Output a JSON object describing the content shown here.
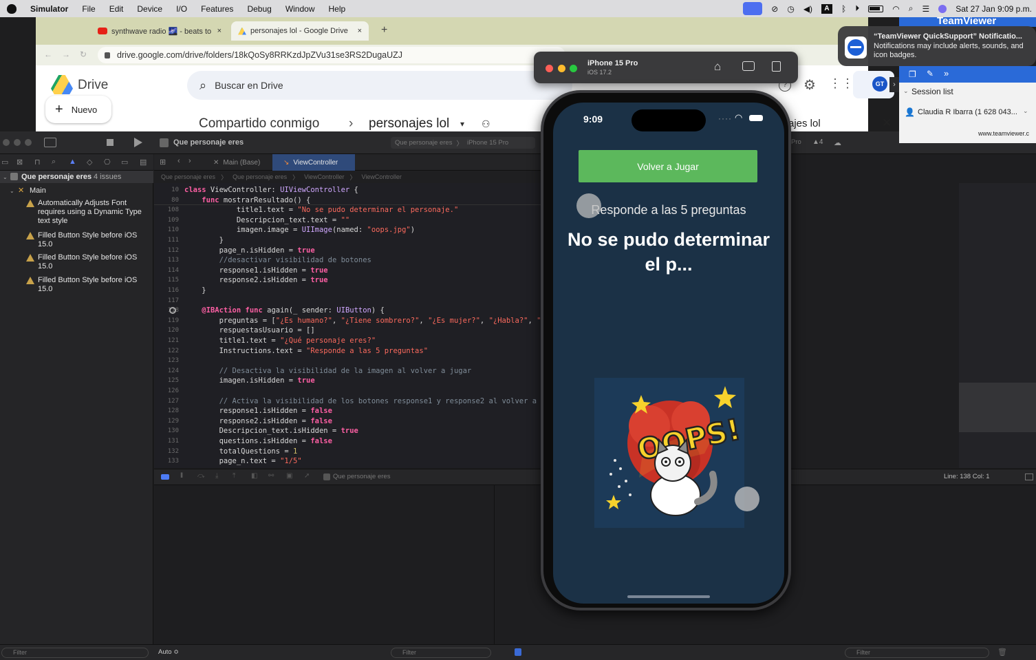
{
  "menubar": {
    "app": "Simulator",
    "items": [
      "File",
      "Edit",
      "Device",
      "I/O",
      "Features",
      "Debug",
      "Window",
      "Help"
    ],
    "clock": "Sat 27 Jan  9:09 p.m."
  },
  "browser": {
    "tabs": [
      {
        "title": "synthwave radio 🌌 - beats to",
        "close": "×"
      },
      {
        "title": "personajes lol - Google Drive",
        "close": "×"
      }
    ],
    "new_tab": "+",
    "url": "drive.google.com/drive/folders/18kQoSy8RRKzdJpZVu31se3RS2DugaUZJ",
    "drive_title": "Drive",
    "search_placeholder": "Buscar en Drive",
    "new_button": "Nuevo",
    "breadcrumb_1": "Compartido conmigo",
    "breadcrumb_sep": "›",
    "breadcrumb_2": "personajes lol",
    "details_title": "ajes lol",
    "details_close": "✕",
    "avatar": "GT"
  },
  "xcode": {
    "project": "Que personaje eres",
    "scheme_target": "Que personaje eres",
    "scheme_device": "iPhone 15 Pro",
    "scheme_device_right": "Pro",
    "warning_count": "▲4",
    "tabs": [
      "Main (Base)",
      "ViewController"
    ],
    "jump": [
      "Que personaje eres",
      "Que personaje eres",
      "ViewController",
      "ViewController"
    ],
    "navigator": {
      "root": "Que personaje eres",
      "root_issues": "4 issues",
      "group": "Main",
      "issues": [
        "Automatically Adjusts Font requires using a Dynamic Type text style",
        "Filled Button Style before iOS 15.0",
        "Filled Button Style before iOS 15.0",
        "Filled Button Style before iOS 15.0"
      ]
    },
    "code_lines": [
      {
        "n": "10",
        "t": "class ViewController: UIViewController {"
      },
      {
        "n": "80",
        "t": "    func mostrarResultado() {"
      },
      {
        "n": "108",
        "t": "            title1.text = \"No se pudo determinar el personaje.\""
      },
      {
        "n": "109",
        "t": "            Descripcion_text.text = \"\""
      },
      {
        "n": "110",
        "t": "            imagen.image = UIImage(named: \"oops.jpg\")"
      },
      {
        "n": "111",
        "t": "        }"
      },
      {
        "n": "112",
        "t": "        page_n.isHidden = true"
      },
      {
        "n": "113",
        "t": "        //desactivar visibilidad de botones"
      },
      {
        "n": "114",
        "t": "        response1.isHidden = true"
      },
      {
        "n": "115",
        "t": "        response2.isHidden = true"
      },
      {
        "n": "116",
        "t": "    }"
      },
      {
        "n": "117",
        "t": ""
      },
      {
        "n": "118",
        "t": "    @IBAction func again(_ sender: UIButton) {"
      },
      {
        "n": "119",
        "t": "        preguntas = [\"¿Es humano?\", \"¿Tiene sombrero?\", \"¿Es mujer?\", \"¿Habla?\", \""
      },
      {
        "n": "120",
        "t": "        respuestasUsuario = []"
      },
      {
        "n": "121",
        "t": "        title1.text = \"¿Qué personaje eres?\""
      },
      {
        "n": "122",
        "t": "        Instructions.text = \"Responde a las 5 preguntas\""
      },
      {
        "n": "123",
        "t": ""
      },
      {
        "n": "124",
        "t": "        // Desactiva la visibilidad de la imagen al volver a jugar"
      },
      {
        "n": "125",
        "t": "        imagen.isHidden = true"
      },
      {
        "n": "126",
        "t": ""
      },
      {
        "n": "127",
        "t": "        // Activa la visibilidad de los botones response1 y response2 al volver a"
      },
      {
        "n": "128",
        "t": "        response1.isHidden = false"
      },
      {
        "n": "129",
        "t": "        response2.isHidden = false"
      },
      {
        "n": "130",
        "t": "        Descripcion_text.isHidden = true"
      },
      {
        "n": "131",
        "t": "        questions.isHidden = false"
      },
      {
        "n": "132",
        "t": "        totalQuestions = 1"
      },
      {
        "n": "133",
        "t": "        page_n.text = \"1/5\""
      }
    ],
    "debug_target": "Que personaje eres",
    "status": "Line: 138  Col: 1",
    "filter_placeholder": "Filter",
    "auto": "Auto ≎"
  },
  "simulator": {
    "device": "iPhone 15 Pro",
    "os": "iOS 17.2",
    "time": "9:09",
    "play_again": "Volver a Jugar",
    "instructions": "Responde a las 5 preguntas",
    "result": "No se pudo determinar el p...",
    "image_text": "OOPS!"
  },
  "teamviewer": {
    "brand": "TeamViewer",
    "notif_title": "“TeamViewer QuickSupport” Notificatio...",
    "notif_body": "Notifications may include alerts, sounds, and icon badges.",
    "session_list": "Session list",
    "session_user": "Claudia R Ibarra (1 628 043...",
    "url": "www.teamviewer.c"
  },
  "colors": {
    "drive_bg": "#ffffff",
    "xcode_bg": "#1e1e20",
    "play_again": "#5cb85c",
    "phone_screen": "#1b3146",
    "teamviewer_blue": "#2a6ad8"
  }
}
